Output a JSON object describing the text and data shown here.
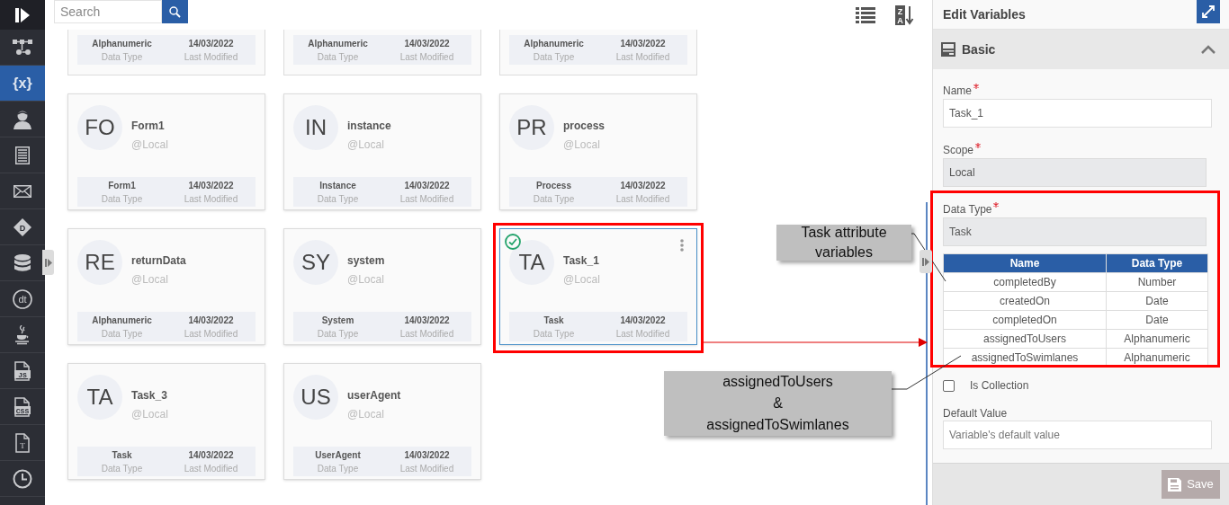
{
  "sidebar": {
    "items": [
      {
        "kind": "flow",
        "selected": false
      },
      {
        "kind": "variables",
        "label": "{x}",
        "selected": true
      },
      {
        "kind": "user",
        "selected": false
      },
      {
        "kind": "document",
        "selected": false
      },
      {
        "kind": "mail",
        "selected": false
      },
      {
        "kind": "decision",
        "label": "D",
        "selected": false
      },
      {
        "kind": "database",
        "selected": false
      },
      {
        "kind": "datatable",
        "label": "dt",
        "selected": false
      },
      {
        "kind": "java",
        "selected": false
      },
      {
        "kind": "script",
        "label": "JS",
        "selected": false
      },
      {
        "kind": "script",
        "label": "CSS",
        "selected": false
      },
      {
        "kind": "textfile",
        "label": "T",
        "selected": false
      },
      {
        "kind": "clock",
        "selected": false
      }
    ]
  },
  "search": {
    "placeholder": "Search"
  },
  "toolbar": {
    "sort_letters": [
      "Z",
      "A"
    ]
  },
  "cards": [
    {
      "kind": "partial",
      "data_type": "Alphanumeric",
      "data_type_label": "Data Type",
      "modified": "14/03/2022",
      "modified_label": "Last Modified",
      "selected": false
    },
    {
      "kind": "partial",
      "data_type": "Alphanumeric",
      "data_type_label": "Data Type",
      "modified": "14/03/2022",
      "modified_label": "Last Modified",
      "selected": false
    },
    {
      "kind": "partial",
      "data_type": "Alphanumeric",
      "data_type_label": "Data Type",
      "modified": "14/03/2022",
      "modified_label": "Last Modified",
      "selected": false
    },
    {
      "kind": "full",
      "avatar": "FO",
      "name": "Form1",
      "scope": "@Local",
      "data_type": "Form1",
      "data_type_label": "Data Type",
      "modified": "14/03/2022",
      "modified_label": "Last Modified",
      "selected": false
    },
    {
      "kind": "full",
      "avatar": "IN",
      "name": "instance",
      "scope": "@Local",
      "data_type": "Instance",
      "data_type_label": "Data Type",
      "modified": "14/03/2022",
      "modified_label": "Last Modified",
      "selected": false
    },
    {
      "kind": "full",
      "avatar": "PR",
      "name": "process",
      "scope": "@Local",
      "data_type": "Process",
      "data_type_label": "Data Type",
      "modified": "14/03/2022",
      "modified_label": "Last Modified",
      "selected": false
    },
    {
      "kind": "full",
      "avatar": "RE",
      "name": "returnData",
      "scope": "@Local",
      "data_type": "Alphanumeric",
      "data_type_label": "Data Type",
      "modified": "14/03/2022",
      "modified_label": "Last Modified",
      "selected": false
    },
    {
      "kind": "full",
      "avatar": "SY",
      "name": "system",
      "scope": "@Local",
      "data_type": "System",
      "data_type_label": "Data Type",
      "modified": "14/03/2022",
      "modified_label": "Last Modified",
      "selected": false
    },
    {
      "kind": "full",
      "avatar": "TA",
      "name": "Task_1",
      "scope": "@Local",
      "data_type": "Task",
      "data_type_label": "Data Type",
      "modified": "14/03/2022",
      "modified_label": "Last Modified",
      "selected": true
    },
    {
      "kind": "full",
      "avatar": "TA",
      "name": "Task_3",
      "scope": "@Local",
      "data_type": "Task",
      "data_type_label": "Data Type",
      "modified": "14/03/2022",
      "modified_label": "Last Modified",
      "selected": false
    },
    {
      "kind": "full",
      "avatar": "US",
      "name": "userAgent",
      "scope": "@Local",
      "data_type": "UserAgent",
      "data_type_label": "Data Type",
      "modified": "14/03/2022",
      "modified_label": "Last Modified",
      "selected": false
    }
  ],
  "panel": {
    "title": "Edit Variables",
    "section": {
      "title": "Basic",
      "expanded": true
    },
    "fields": [
      {
        "label": "Name",
        "required": true,
        "value": "Task_1",
        "disabled": false
      },
      {
        "label": "Scope",
        "required": true,
        "value": "Local",
        "disabled": true
      },
      {
        "label": "Data Type",
        "required": true,
        "value": "Task",
        "disabled": true
      }
    ],
    "attributes": {
      "columns": [
        "Name",
        "Data Type"
      ],
      "rows": [
        [
          "completedBy",
          "Number"
        ],
        [
          "createdOn",
          "Date"
        ],
        [
          "completedOn",
          "Date"
        ],
        [
          "assignedToUsers",
          "Alphanumeric"
        ],
        [
          "assignedToSwimlanes",
          "Alphanumeric"
        ]
      ]
    },
    "is_collection": {
      "label": "Is Collection",
      "checked": false
    },
    "default_value": {
      "label": "Default Value",
      "placeholder": "Variable's default value"
    },
    "save": {
      "label": "Save",
      "disabled": true
    }
  },
  "annotations": [
    {
      "lines": [
        "Task attribute",
        "variables"
      ]
    },
    {
      "lines": [
        "assignedToUsers",
        "&",
        "assignedToSwimlanes"
      ]
    }
  ]
}
